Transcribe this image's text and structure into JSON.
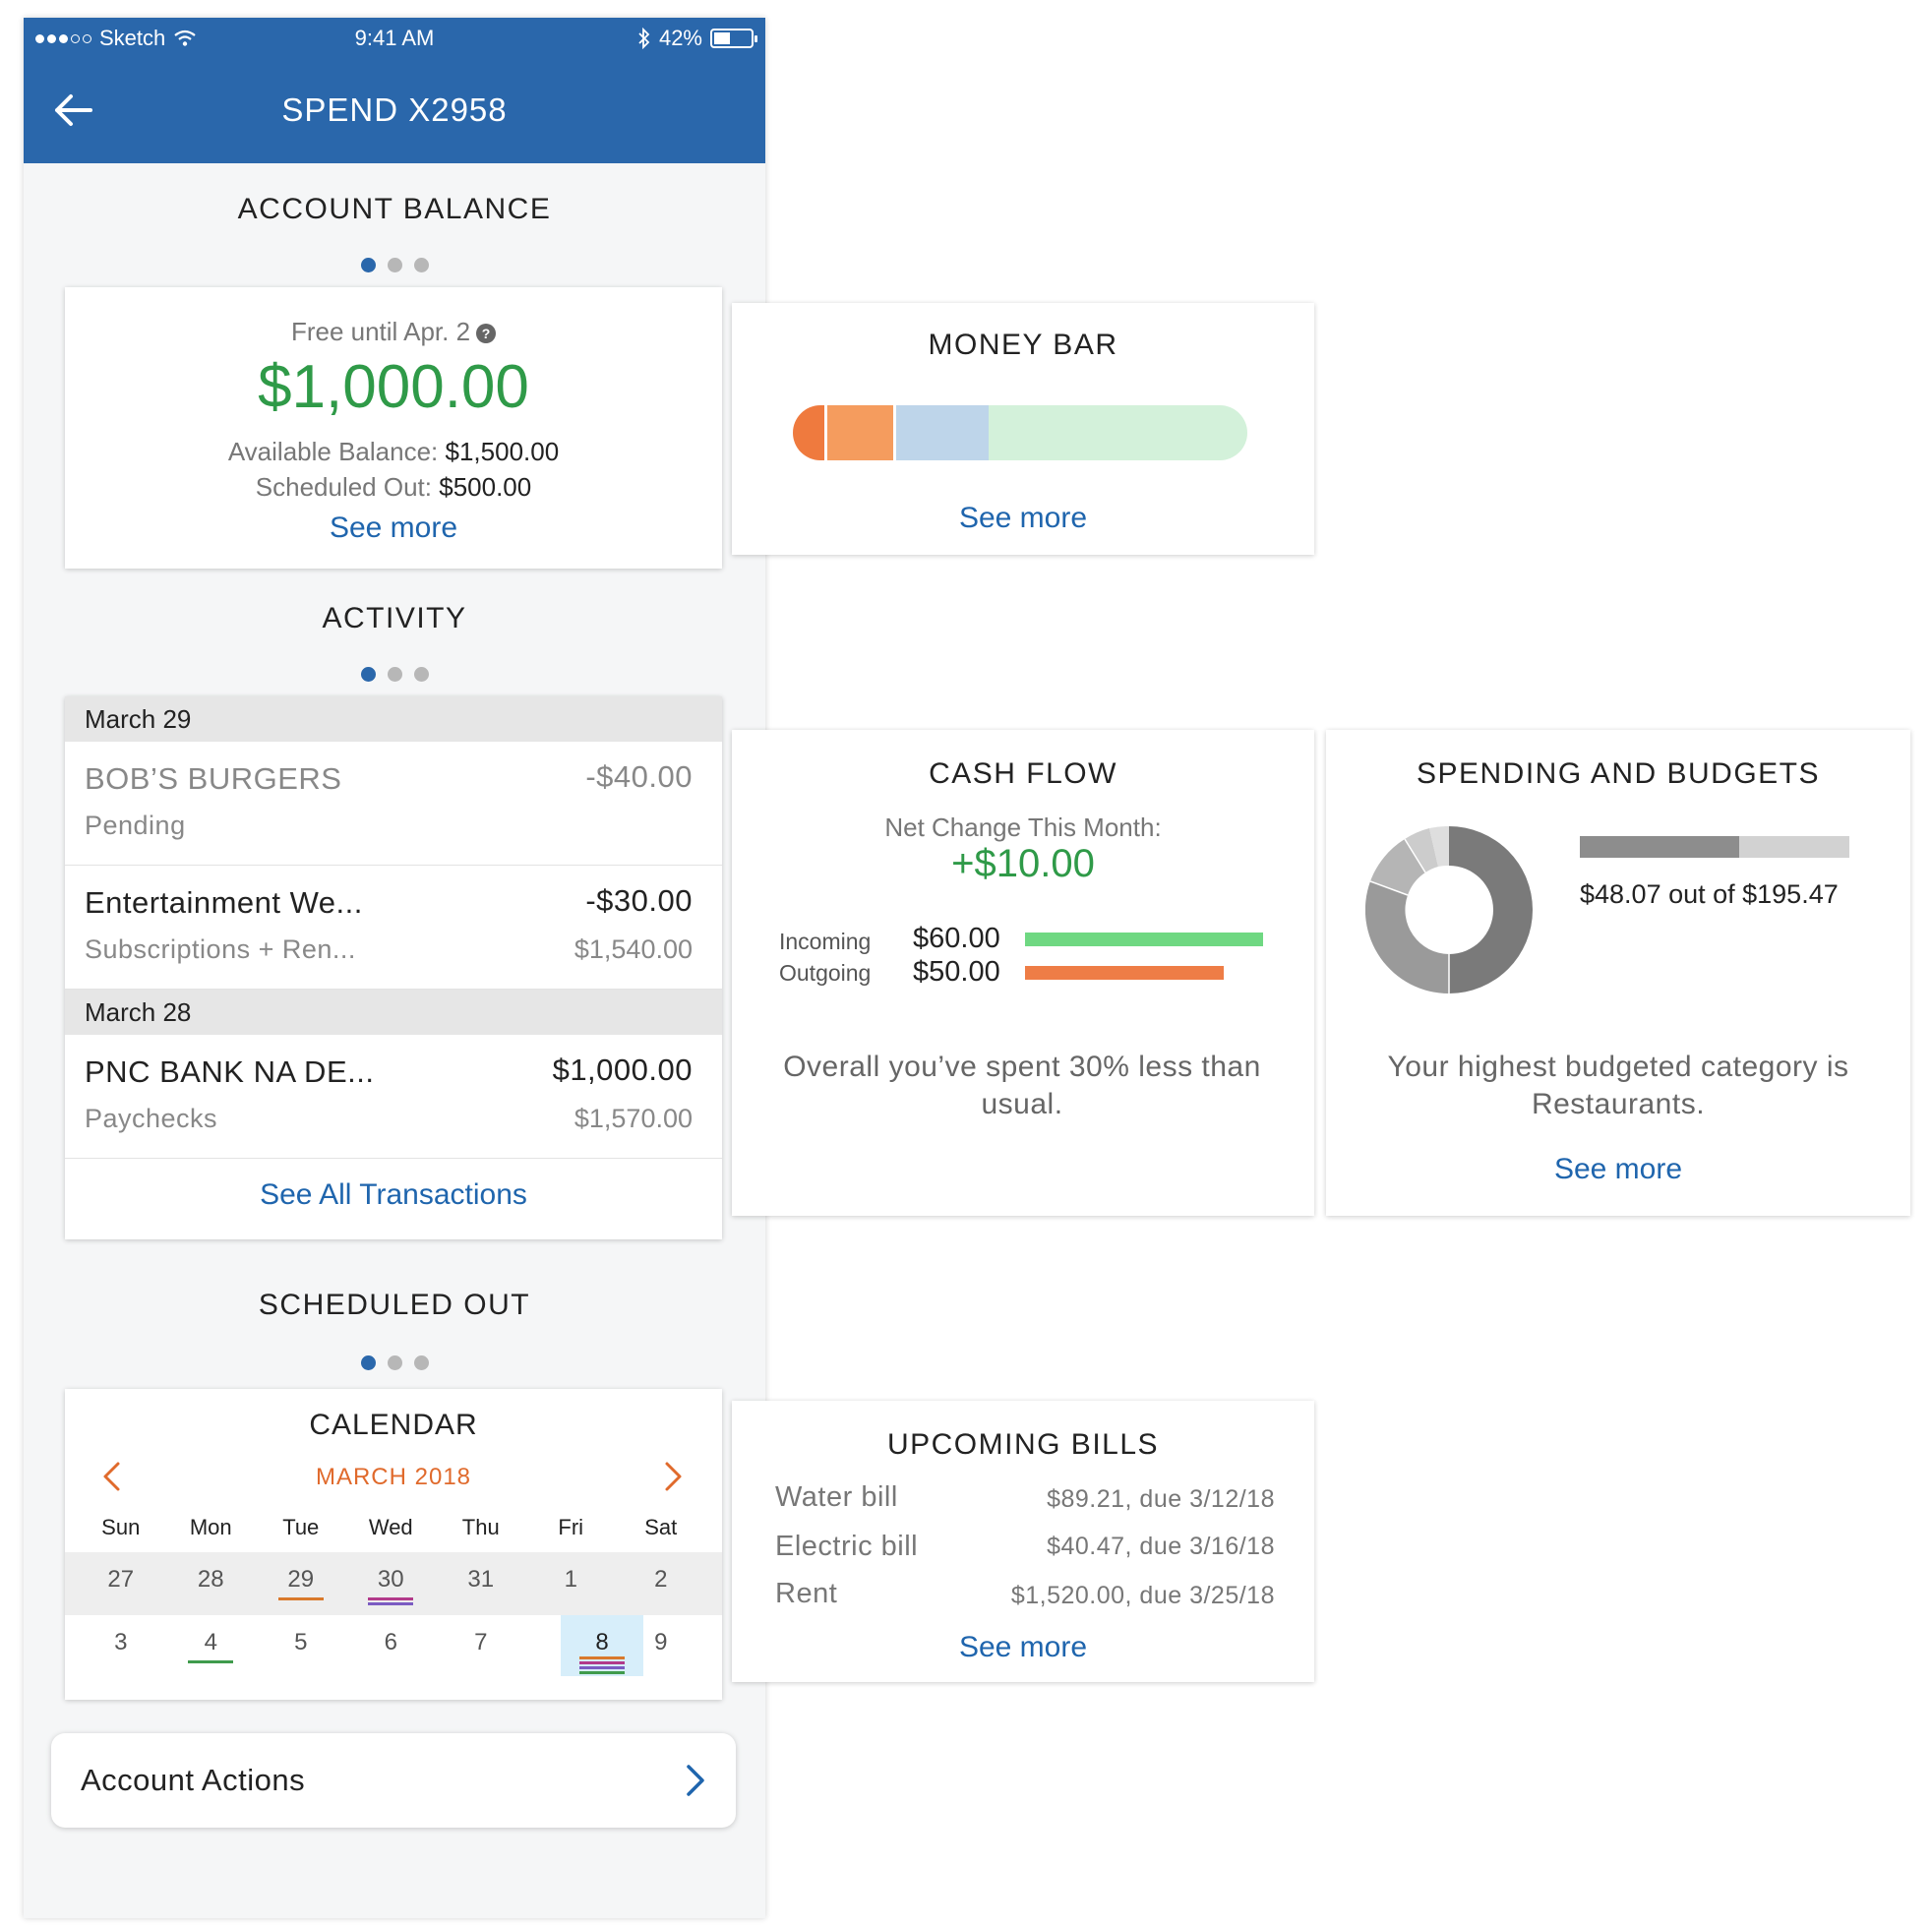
{
  "status_bar": {
    "carrier": "Sketch",
    "time": "9:41 AM",
    "battery": "42%"
  },
  "nav": {
    "title": "SPEND X2958",
    "back_icon": "arrow-left-icon"
  },
  "account_balance": {
    "title": "ACCOUNT BALANCE",
    "free_until": "Free until Apr. 2",
    "help_icon": "question-circle-icon",
    "amount": "$1,000.00",
    "available_label": "Available Balance:",
    "available_value": "$1,500.00",
    "scheduled_label": "Scheduled Out:",
    "scheduled_value": "$500.00",
    "see_more": "See more"
  },
  "activity": {
    "title": "ACTIVITY",
    "groups": [
      {
        "date": "March 29",
        "transactions": [
          {
            "name": "BOB’S BURGERS",
            "sub": "Pending",
            "amount": "-$40.00",
            "balance": ""
          },
          {
            "name": "Entertainment We...",
            "sub": "Subscriptions + Ren...",
            "amount": "-$30.00",
            "balance": "$1,540.00"
          }
        ]
      },
      {
        "date": "March 28",
        "transactions": [
          {
            "name": "PNC BANK NA DE...",
            "sub": "Paychecks",
            "amount": "$1,000.00",
            "balance": "$1,570.00"
          }
        ]
      }
    ],
    "see_all": "See All Transactions"
  },
  "scheduled_out": {
    "title": "SCHEDULED OUT",
    "calendar": {
      "title": "CALENDAR",
      "month": "MARCH 2018",
      "weekdays": [
        "Sun",
        "Mon",
        "Tue",
        "Wed",
        "Thu",
        "Fri",
        "Sat"
      ],
      "weeks": [
        [
          "27",
          "28",
          "29",
          "30",
          "31",
          "1",
          "2"
        ],
        [
          "3",
          "4",
          "5",
          "6",
          "7",
          "8",
          "9"
        ]
      ],
      "today": "8"
    }
  },
  "account_actions": {
    "label": "Account Actions"
  },
  "money_bar": {
    "title": "MONEY BAR",
    "see_more": "See more",
    "segments": [
      {
        "color": "#ef7a3e",
        "fraction": 0.07
      },
      {
        "color": "#f59c5e",
        "fraction": 0.15
      },
      {
        "color": "#bed5ea",
        "fraction": 0.21
      },
      {
        "color": "#d3f1da",
        "fraction": 0.57
      }
    ]
  },
  "cash_flow": {
    "title": "CASH FLOW",
    "net_label": "Net Change This Month:",
    "net_value": "+$10.00",
    "incoming_label": "Incoming",
    "incoming_value": "$60.00",
    "outgoing_label": "Outgoing",
    "outgoing_value": "$50.00",
    "incoming_color": "#6fd882",
    "outgoing_color": "#ee7d46",
    "note": "Overall you’ve spent 30% less than usual."
  },
  "spending_budgets": {
    "title": "SPENDING AND BUDGETS",
    "spent_fraction": 0.59,
    "summary": "$48.07 out of $195.47",
    "note": "Your highest budgeted category is Restaurants.",
    "see_more": "See more"
  },
  "upcoming_bills": {
    "title": "UPCOMING BILLS",
    "bills": [
      {
        "name": "Water bill",
        "detail": "$89.21, due 3/12/18"
      },
      {
        "name": "Electric bill",
        "detail": "$40.47, due 3/16/18"
      },
      {
        "name": "Rent",
        "detail": "$1,520.00, due 3/25/18"
      }
    ],
    "see_more": "See more"
  }
}
